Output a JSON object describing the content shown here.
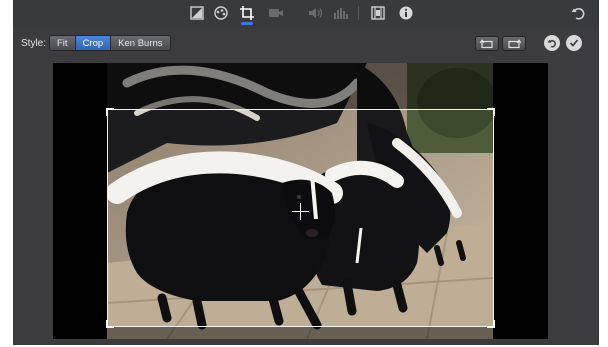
{
  "toolbar": {
    "tools": [
      {
        "name": "color-balance-icon",
        "active": false
      },
      {
        "name": "color-correction-icon",
        "active": false
      },
      {
        "name": "crop-icon",
        "active": true
      },
      {
        "name": "stabilization-icon",
        "active": false
      },
      {
        "name": "volume-icon",
        "active": false
      },
      {
        "name": "noise-reduction-icon",
        "active": false
      },
      {
        "name": "clip-filter-icon",
        "active": false
      },
      {
        "name": "info-icon",
        "active": false
      },
      {
        "name": "reset-all-icon",
        "active": false
      }
    ]
  },
  "stylebar": {
    "label": "Style:",
    "options": [
      "Fit",
      "Crop",
      "Ken Burns"
    ],
    "selected": "Crop"
  },
  "colors": {
    "accent": "#3b79d9",
    "toolbar_bg": "#393a3c",
    "viewer_bg": "#000000"
  }
}
